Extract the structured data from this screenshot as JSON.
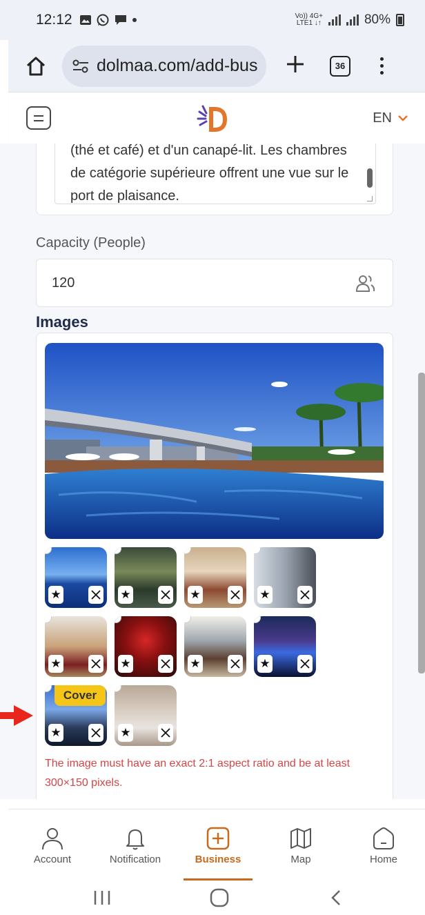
{
  "status_bar": {
    "time": "12:12",
    "network_top": "Vo)) 4G+",
    "network_bottom": "LTE1 ↓↑",
    "battery": "80%"
  },
  "browser": {
    "url": "dolmaa.com/add-bus",
    "tab_count": "36"
  },
  "header": {
    "language": "EN"
  },
  "description": {
    "text": "(thé et café) et d'un canapé-lit. Les chambres de catégorie supérieure offrent une vue sur le port de plaisance."
  },
  "capacity": {
    "label": "Capacity (People)",
    "value": "120"
  },
  "images": {
    "title": "Images",
    "cover_label": "Cover",
    "error": "The image must have an exact 2:1 aspect ratio and be at least 300×150 pixels."
  },
  "bottom_nav": {
    "items": [
      {
        "label": "Account"
      },
      {
        "label": "Notification"
      },
      {
        "label": "Business"
      },
      {
        "label": "Map"
      },
      {
        "label": "Home"
      }
    ]
  },
  "colors": {
    "accent": "#c56a1e",
    "error": "#d64545",
    "cover_badge": "#f5c518",
    "title": "#1e2a4a",
    "annotation_arrow": "#e8261c"
  }
}
